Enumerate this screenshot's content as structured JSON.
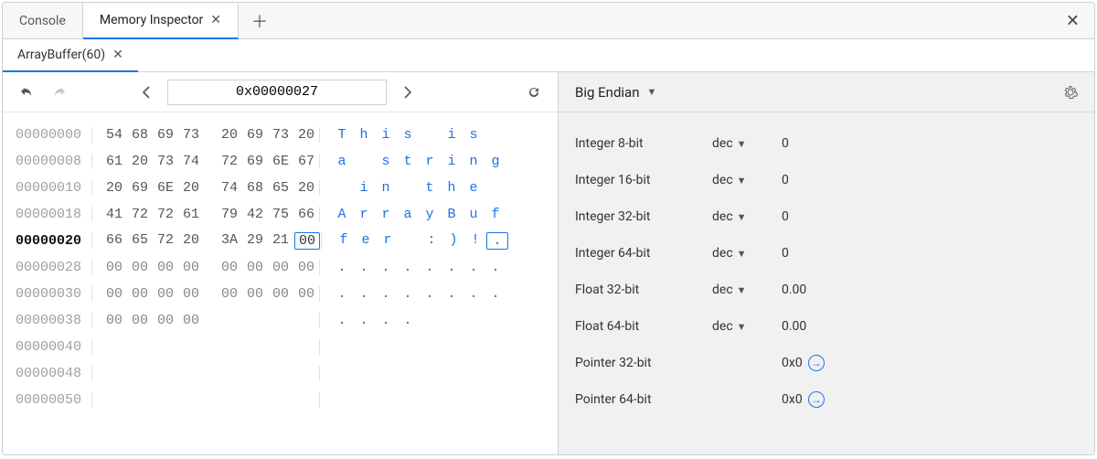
{
  "tabs": {
    "outer": [
      {
        "label": "Console",
        "active": false
      },
      {
        "label": "Memory Inspector",
        "active": true
      }
    ],
    "inner": {
      "label": "ArrayBuffer(60)"
    }
  },
  "toolbar": {
    "address": "0x00000027"
  },
  "hex": {
    "current_address": "00000020",
    "selected_byte_index": 7,
    "rows": [
      {
        "addr": "00000000",
        "bytes": [
          "54",
          "68",
          "69",
          "73",
          "20",
          "69",
          "73",
          "20"
        ],
        "ascii": [
          "T",
          "h",
          "i",
          "s",
          " ",
          "i",
          "s",
          " "
        ]
      },
      {
        "addr": "00000008",
        "bytes": [
          "61",
          "20",
          "73",
          "74",
          "72",
          "69",
          "6E",
          "67"
        ],
        "ascii": [
          "a",
          " ",
          "s",
          "t",
          "r",
          "i",
          "n",
          "g"
        ]
      },
      {
        "addr": "00000010",
        "bytes": [
          "20",
          "69",
          "6E",
          "20",
          "74",
          "68",
          "65",
          "20"
        ],
        "ascii": [
          " ",
          "i",
          "n",
          " ",
          "t",
          "h",
          "e",
          " "
        ]
      },
      {
        "addr": "00000018",
        "bytes": [
          "41",
          "72",
          "72",
          "61",
          "79",
          "42",
          "75",
          "66"
        ],
        "ascii": [
          "A",
          "r",
          "r",
          "a",
          "y",
          "B",
          "u",
          "f"
        ]
      },
      {
        "addr": "00000020",
        "bytes": [
          "66",
          "65",
          "72",
          "20",
          "3A",
          "29",
          "21",
          "00"
        ],
        "ascii": [
          "f",
          "e",
          "r",
          " ",
          ":",
          ")",
          "!",
          "."
        ]
      },
      {
        "addr": "00000028",
        "bytes": [
          "00",
          "00",
          "00",
          "00",
          "00",
          "00",
          "00",
          "00"
        ],
        "ascii": [
          ".",
          ".",
          ".",
          ".",
          ".",
          ".",
          ".",
          "."
        ]
      },
      {
        "addr": "00000030",
        "bytes": [
          "00",
          "00",
          "00",
          "00",
          "00",
          "00",
          "00",
          "00"
        ],
        "ascii": [
          ".",
          ".",
          ".",
          ".",
          ".",
          ".",
          ".",
          "."
        ]
      },
      {
        "addr": "00000038",
        "bytes": [
          "00",
          "00",
          "00",
          "00"
        ],
        "ascii": [
          ".",
          ".",
          ".",
          "."
        ]
      },
      {
        "addr": "00000040",
        "bytes": [],
        "ascii": []
      },
      {
        "addr": "00000048",
        "bytes": [],
        "ascii": []
      },
      {
        "addr": "00000050",
        "bytes": [],
        "ascii": []
      }
    ]
  },
  "endian": {
    "label": "Big Endian"
  },
  "values": [
    {
      "label": "Integer 8-bit",
      "fmt": "dec",
      "value": "0"
    },
    {
      "label": "Integer 16-bit",
      "fmt": "dec",
      "value": "0"
    },
    {
      "label": "Integer 32-bit",
      "fmt": "dec",
      "value": "0"
    },
    {
      "label": "Integer 64-bit",
      "fmt": "dec",
      "value": "0"
    },
    {
      "label": "Float 32-bit",
      "fmt": "dec",
      "value": "0.00"
    },
    {
      "label": "Float 64-bit",
      "fmt": "dec",
      "value": "0.00"
    },
    {
      "label": "Pointer 32-bit",
      "fmt": "",
      "value": "0x0",
      "pointer": true
    },
    {
      "label": "Pointer 64-bit",
      "fmt": "",
      "value": "0x0",
      "pointer": true
    }
  ]
}
